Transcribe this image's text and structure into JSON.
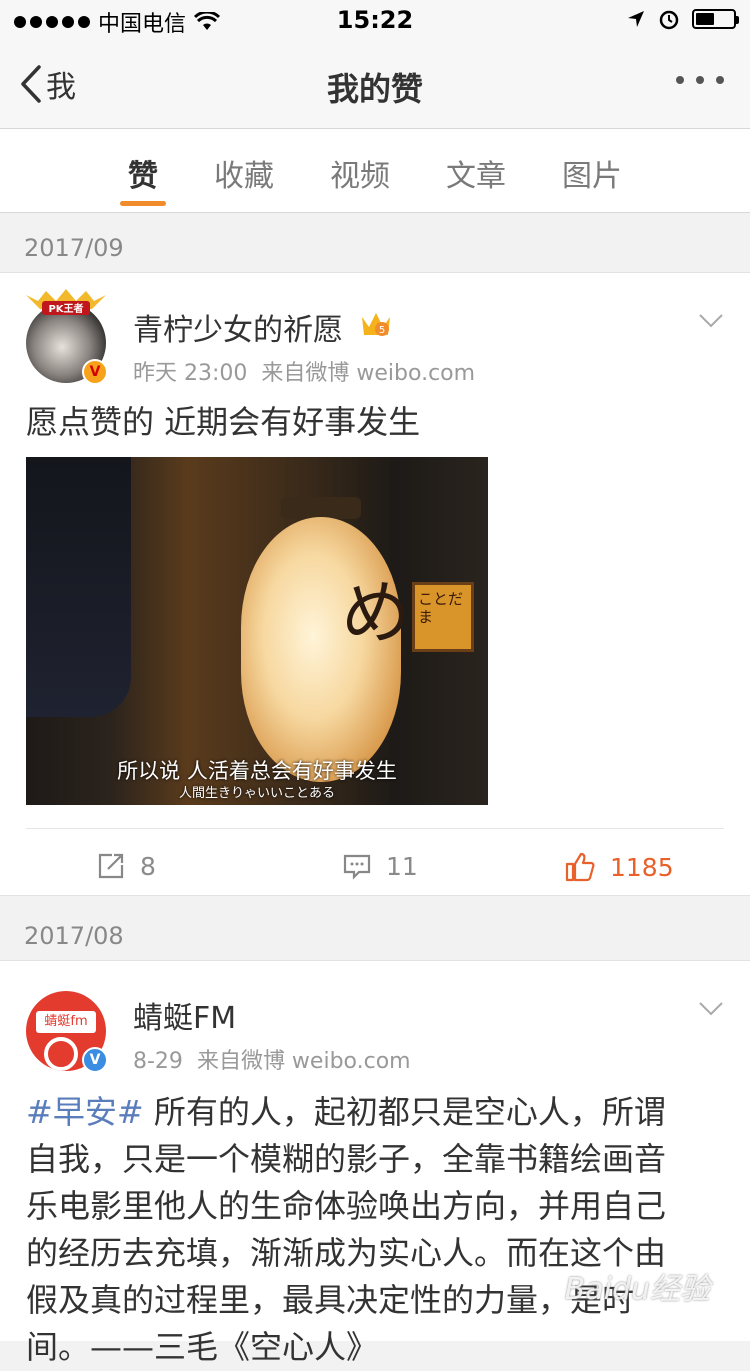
{
  "status_bar": {
    "carrier": "中国电信",
    "time": "15:22"
  },
  "nav": {
    "back_label": "我",
    "title": "我的赞"
  },
  "tabs": [
    {
      "label": "赞",
      "active": true
    },
    {
      "label": "收藏",
      "active": false
    },
    {
      "label": "视频",
      "active": false
    },
    {
      "label": "文章",
      "active": false
    },
    {
      "label": "图片",
      "active": false
    }
  ],
  "sections": [
    {
      "date": "2017/09",
      "post": {
        "username": "青柠少女的祈愿",
        "badge_number": "5",
        "avatar_badge_text": "PK王者",
        "time": "昨天 23:00",
        "source": "来自微博 weibo.com",
        "text": "愿点赞的 近期会有好事发生",
        "image": {
          "subtitle_cn": "所以说 人活着总会有好事发生",
          "subtitle_jp": "人間生きりゃいいことある",
          "lantern_char": "め",
          "sign_text": "ことだま"
        },
        "reposts": "8",
        "comments": "11",
        "likes": "1185"
      }
    },
    {
      "date": "2017/08",
      "post": {
        "username": "蜻蜓FM",
        "avatar_label": "蜻蜓fm",
        "time": "8-29",
        "source": "来自微博 weibo.com",
        "hashtag": "#早安#",
        "text_lines": [
          " 所有的人，起初都只是空心人，所谓",
          "自我，只是一个模糊的影子，全靠书籍绘画音",
          "乐电影里他人的生命体验唤出方向，并用自己",
          "的经历去充填，渐渐成为实心人。而在这个由",
          "假及真的过程里，最具决定性的力量，是时",
          "间。——三毛《空心人》"
        ]
      }
    }
  ],
  "watermark": "Baidu经验",
  "colors": {
    "accent": "#f08c2c",
    "liked": "#e8612b",
    "hashtag": "#5a7dbb"
  }
}
